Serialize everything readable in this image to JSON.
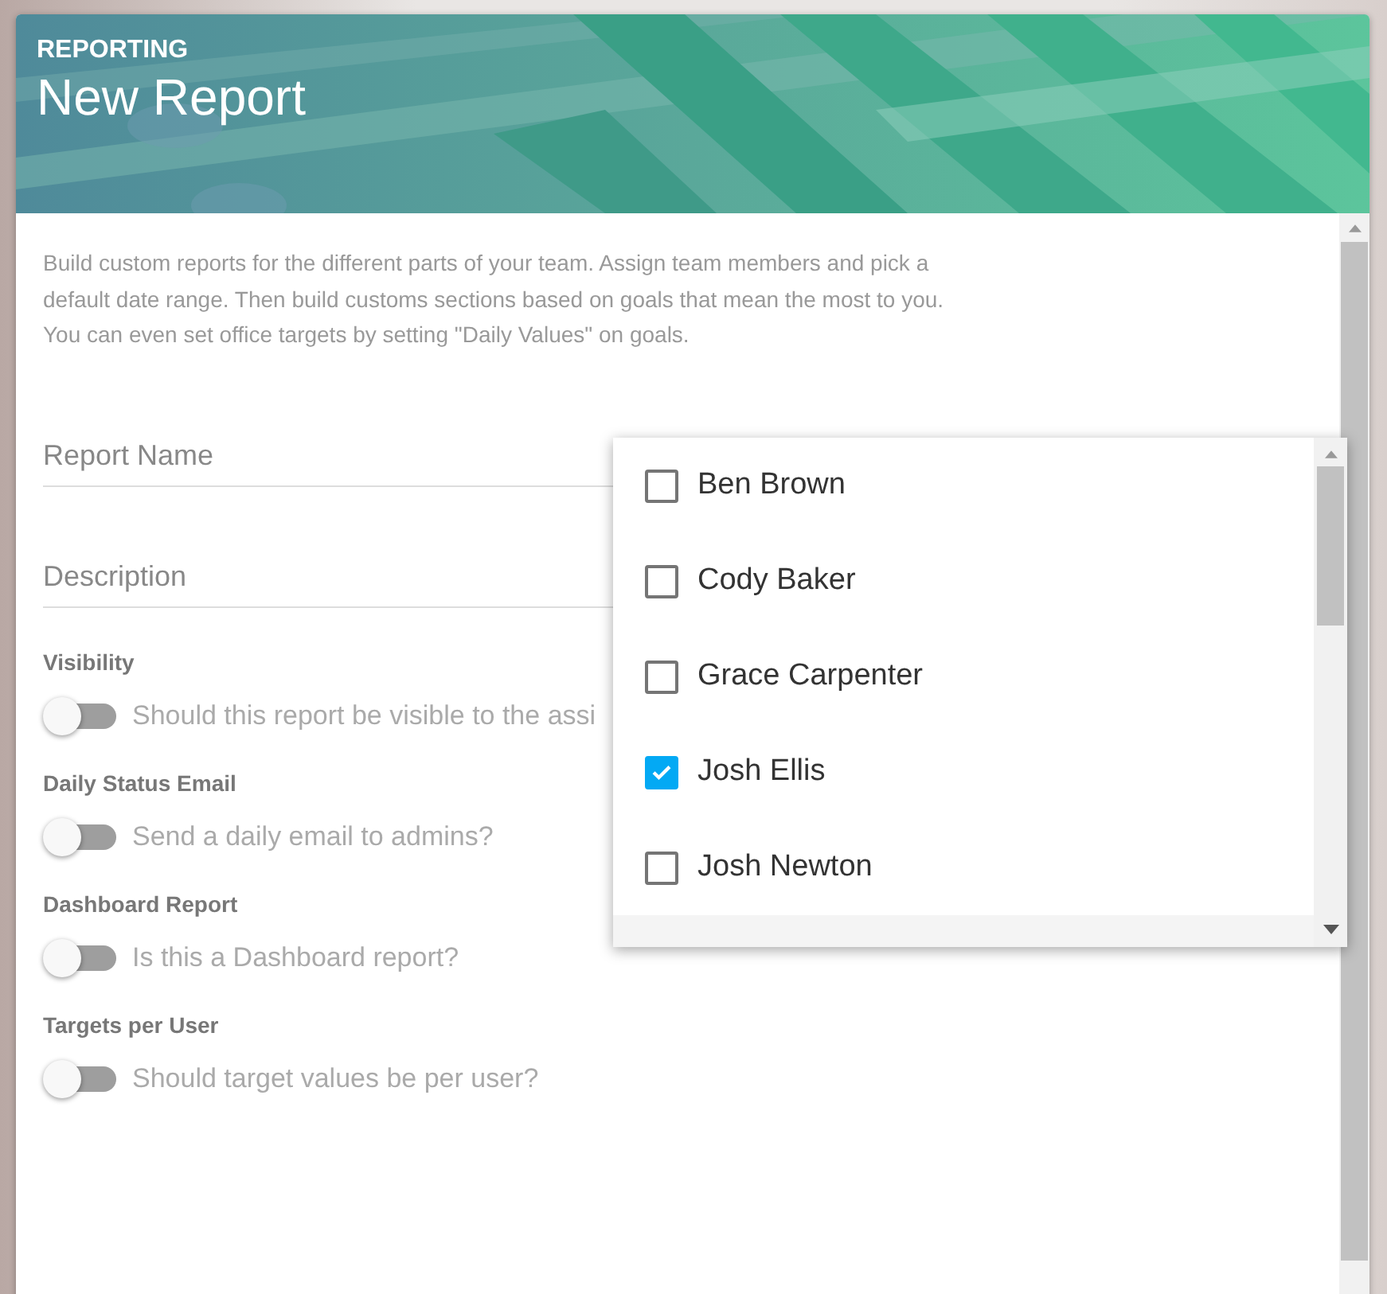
{
  "header": {
    "section": "REPORTING",
    "title": "New Report",
    "kind": "picture"
  },
  "intro": "Build custom reports for the different parts of your team. Assign team members and pick a default date range. Then build customs sections based on goals that mean the most to you. You can even set office targets by setting \"Daily Values\" on goals.",
  "fields": [
    {
      "placeholder": "Report Name"
    },
    {
      "placeholder": "Description"
    }
  ],
  "settings": [
    {
      "label": "Visibility",
      "text": "Should this report be visible to the assi",
      "on": false
    },
    {
      "label": "Daily Status Email",
      "text": "Send a daily email to admins?",
      "on": false
    },
    {
      "label": "Dashboard Report",
      "text": "Is this a Dashboard report?",
      "on": false
    },
    {
      "label": "Targets per User",
      "text": "Should target values be per user?",
      "on": false
    }
  ],
  "users_dropdown": {
    "items": [
      {
        "name": "Ben Brown",
        "checked": false
      },
      {
        "name": "Cody Baker",
        "checked": false
      },
      {
        "name": "Grace Carpenter",
        "checked": false
      },
      {
        "name": "Josh Ellis",
        "checked": true
      },
      {
        "name": "Josh Newton",
        "checked": false
      }
    ]
  }
}
